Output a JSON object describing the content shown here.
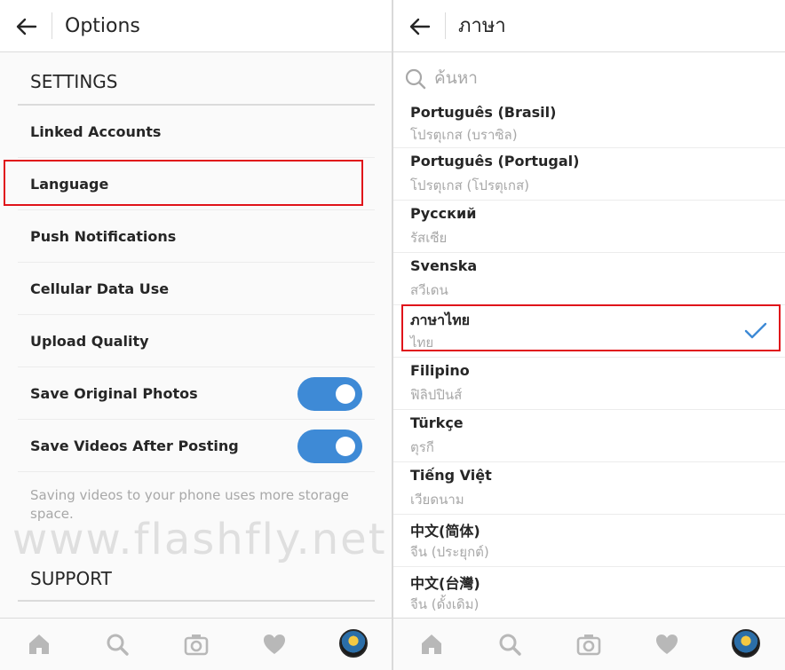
{
  "left": {
    "title": "Options",
    "settings_header": "SETTINGS",
    "rows": [
      {
        "label": "Linked Accounts"
      },
      {
        "label": "Language"
      },
      {
        "label": "Push Notifications"
      },
      {
        "label": "Cellular Data Use"
      },
      {
        "label": "Upload Quality"
      },
      {
        "label": "Save Original Photos",
        "toggle": true
      },
      {
        "label": "Save Videos After Posting",
        "toggle": true
      }
    ],
    "note": "Saving videos to your phone uses more storage space.",
    "support_header": "SUPPORT",
    "watermark": "www.flashfly.net"
  },
  "right": {
    "title": "ภาษา",
    "search_placeholder": "ค้นหา",
    "languages": [
      {
        "name": "Português (Brasil)",
        "native": "โปรตุเกส (บราซิล)"
      },
      {
        "name": "Português (Portugal)",
        "native": "โปรตุเกส (โปรตุเกส)"
      },
      {
        "name": "Русский",
        "native": "รัสเซีย"
      },
      {
        "name": "Svenska",
        "native": "สวีเดน"
      },
      {
        "name": "ภาษาไทย",
        "native": "ไทย",
        "selected": true
      },
      {
        "name": "Filipino",
        "native": "ฟิลิปปินส์"
      },
      {
        "name": "Türkçe",
        "native": "ตุรกี"
      },
      {
        "name": "Tiếng Việt",
        "native": "เวียดนาม"
      },
      {
        "name": "中文(简体)",
        "native": "จีน (ประยุกต์)"
      },
      {
        "name": "中文(台灣)",
        "native": "จีน (ดั้งเดิม)"
      }
    ]
  },
  "tabbar": [
    "home-icon",
    "search-icon",
    "camera-icon",
    "heart-icon",
    "profile-avatar"
  ],
  "colors": {
    "toggle_on": "#3e8ad6",
    "highlight": "#e0131a",
    "check": "#3e8ad6"
  }
}
